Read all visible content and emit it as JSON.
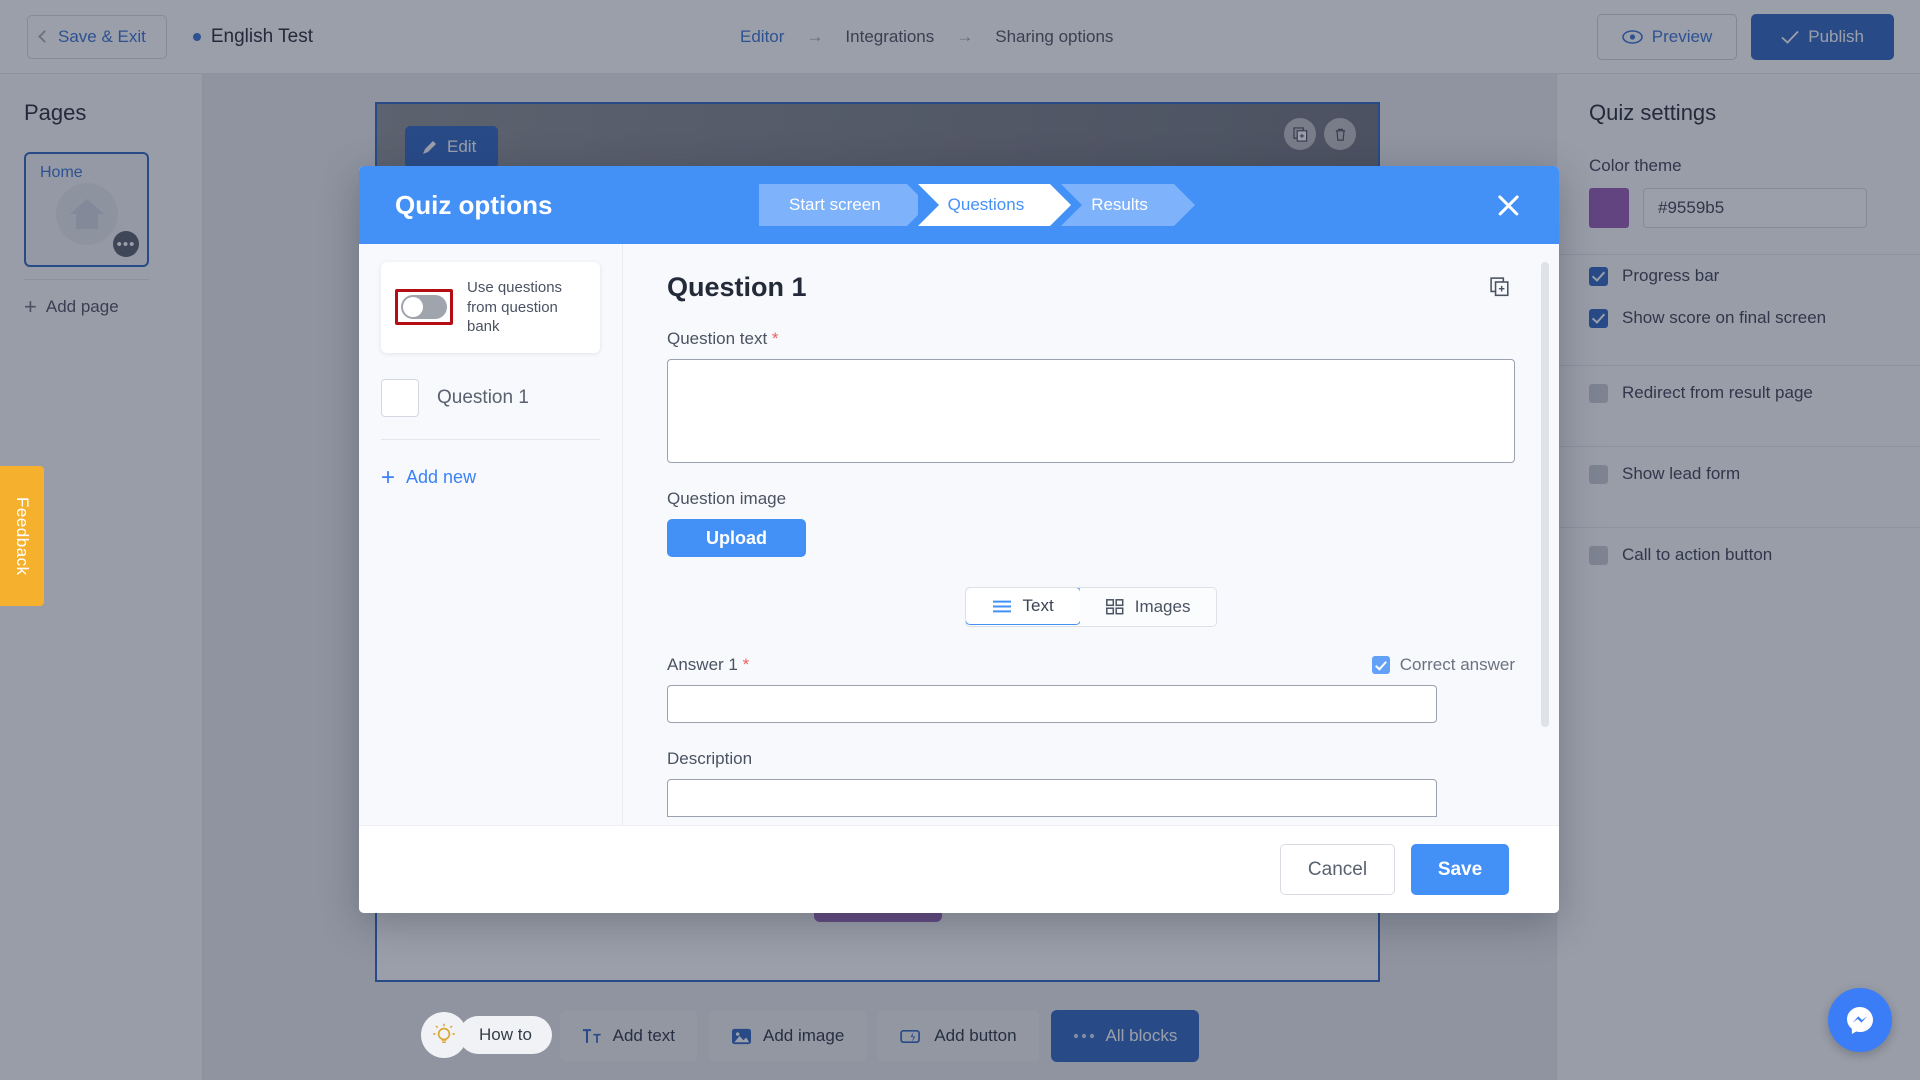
{
  "topbar": {
    "save_exit": "Save & Exit",
    "doc_title": "English Test",
    "breadcrumb": [
      {
        "label": "Editor",
        "active": true
      },
      {
        "label": "Integrations",
        "active": false
      },
      {
        "label": "Sharing options",
        "active": false
      }
    ],
    "arrow": "→",
    "preview": "Preview",
    "publish": "Publish"
  },
  "left_sidebar": {
    "title": "Pages",
    "page_card": {
      "label": "Home",
      "menu": "•••",
      "icon": "home-icon"
    },
    "add_page": "Add page"
  },
  "feedback": {
    "label": "Feedback",
    "color": "#f5b12d"
  },
  "canvas": {
    "edit_button": "Edit",
    "block_tools": [
      "duplicate-icon",
      "trash-icon"
    ],
    "accent_block_color": "#9559b5"
  },
  "bottom_toolbar": {
    "items": [
      {
        "label": "Add text",
        "icon": "text-icon",
        "primary": false
      },
      {
        "label": "Add image",
        "icon": "image-icon",
        "primary": false
      },
      {
        "label": "Add button",
        "icon": "button-icon",
        "primary": false
      },
      {
        "label": "All blocks",
        "icon": "ellipsis-icon",
        "primary": true
      }
    ]
  },
  "how_to": {
    "label": "How to",
    "icon": "lightbulb-icon"
  },
  "messenger": {
    "icon": "messenger-icon",
    "color": "#3b7df6"
  },
  "right_sidebar": {
    "title": "Quiz settings",
    "color_theme_label": "Color theme",
    "color_value": "#9559b5",
    "options": [
      {
        "label": "Progress bar",
        "checked": true
      },
      {
        "label": "Show score on final screen",
        "checked": true
      },
      {
        "label": "Redirect from result page",
        "checked": false
      },
      {
        "label": "Show lead form",
        "checked": false
      },
      {
        "label": "Call to action button",
        "checked": false
      }
    ]
  },
  "modal": {
    "title": "Quiz options",
    "steps": [
      {
        "label": "Start screen",
        "current": false
      },
      {
        "label": "Questions",
        "current": true
      },
      {
        "label": "Results",
        "current": false
      }
    ],
    "close_icon": "close-icon",
    "left": {
      "question_bank_label": "Use questions from question bank",
      "question_bank_on": false,
      "highlight_color": "#b50d15",
      "questions": [
        {
          "label": "Question 1"
        }
      ],
      "add_new": "Add new"
    },
    "main": {
      "heading": "Question 1",
      "duplicate_icon": "duplicate-icon",
      "question_text_label": "Question text",
      "question_text_value": "",
      "required_mark": "*",
      "question_image_label": "Question image",
      "upload_label": "Upload",
      "answer_type": [
        {
          "label": "Text",
          "icon": "list-icon",
          "selected": true
        },
        {
          "label": "Images",
          "icon": "grid-icon",
          "selected": false
        }
      ],
      "answer_label": "Answer 1",
      "answer_value": "",
      "correct_answer_label": "Correct answer",
      "correct_answer_checked": true,
      "description_label": "Description",
      "description_value": ""
    },
    "footer": {
      "cancel": "Cancel",
      "save": "Save"
    }
  }
}
